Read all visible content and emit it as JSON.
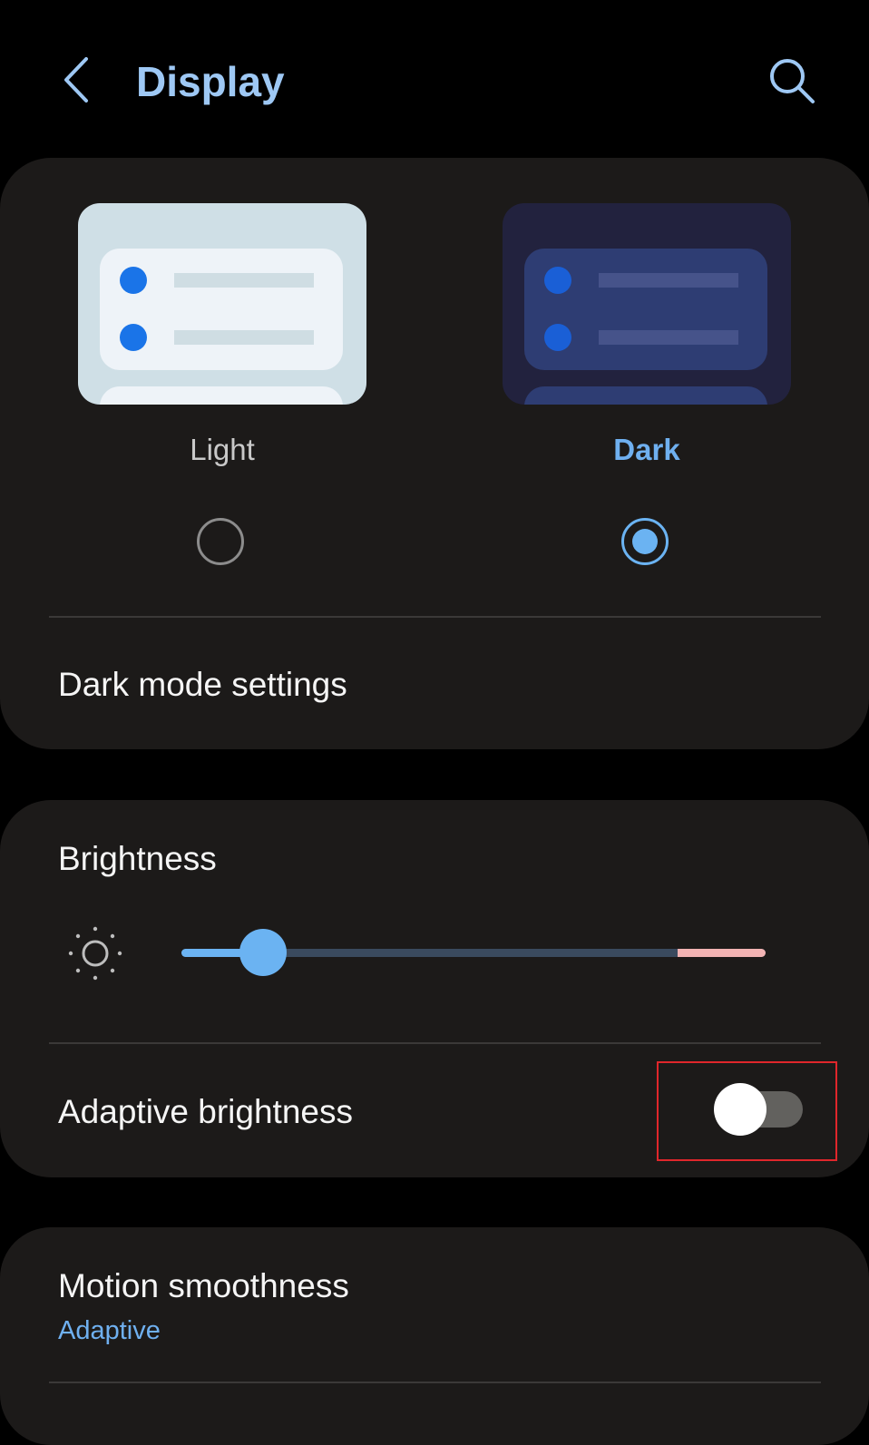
{
  "header": {
    "title": "Display",
    "back_icon": "chevron-left-icon",
    "search_icon": "search-icon",
    "accent_color": "#9ec8f4"
  },
  "theme": {
    "options": [
      {
        "label": "Light",
        "selected": false
      },
      {
        "label": "Dark",
        "selected": true
      }
    ],
    "dark_mode_settings_label": "Dark mode settings"
  },
  "brightness": {
    "title": "Brightness",
    "icon": "sun-icon",
    "level": 0.14,
    "extra_brightness_start": 0.85,
    "accent_color": "#6bb3f2",
    "warn_color": "#f2b3b3"
  },
  "adaptive_brightness": {
    "label": "Adaptive brightness",
    "enabled": false,
    "highlight_color": "#e0262b"
  },
  "motion_smoothness": {
    "title": "Motion smoothness",
    "value": "Adaptive"
  }
}
